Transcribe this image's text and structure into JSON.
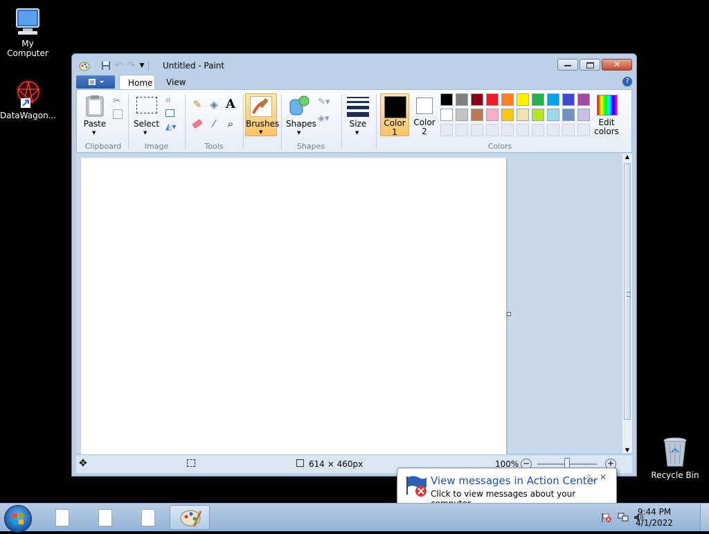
{
  "desktop": {
    "icons": [
      {
        "label": "My Computer"
      },
      {
        "label": "DataWagon..."
      },
      {
        "label": "Recycle Bin"
      }
    ]
  },
  "window": {
    "title": "Untitled - Paint",
    "tabs": [
      {
        "label": "Home"
      },
      {
        "label": "View"
      }
    ],
    "ribbon": {
      "clipboard": {
        "paste": "Paste",
        "group": "Clipboard"
      },
      "image": {
        "select": "Select",
        "group": "Image"
      },
      "tools": {
        "group": "Tools"
      },
      "brushes": {
        "label": "Brushes"
      },
      "shapes": {
        "label": "Shapes",
        "group": "Shapes"
      },
      "size": {
        "label": "Size"
      },
      "color1": {
        "line1": "Color",
        "line2": "1"
      },
      "color2": {
        "line1": "Color",
        "line2": "2"
      },
      "edit_colors": {
        "line1": "Edit",
        "line2": "colors"
      },
      "colors_group": "Colors",
      "palette_row1": [
        "#000000",
        "#7f7f7f",
        "#880015",
        "#ed1c24",
        "#ff7f27",
        "#fff200",
        "#22b14c",
        "#00a2e8",
        "#3f48cc",
        "#a349a4"
      ],
      "palette_row2": [
        "#ffffff",
        "#c3c3c3",
        "#b97a57",
        "#ffaec9",
        "#ffc90e",
        "#efe4b0",
        "#b5e61d",
        "#99d9ea",
        "#7092be",
        "#c8bfe7"
      ]
    },
    "status": {
      "dimensions": "614 × 460px",
      "zoom": "100%"
    }
  },
  "balloon": {
    "title": "View messages in Action Center",
    "subtitle": "Click to view messages about your computer."
  },
  "taskbar": {
    "time": "9:44 PM",
    "date": "4/1/2022"
  }
}
